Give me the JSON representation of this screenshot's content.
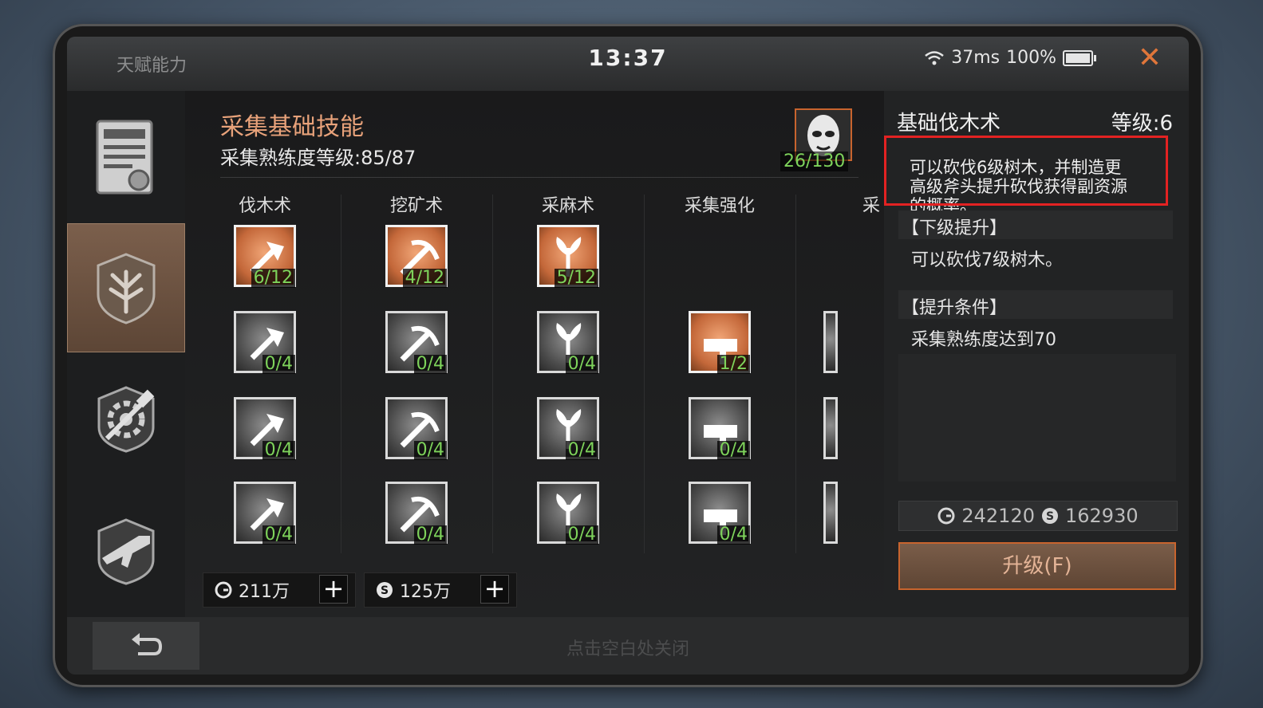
{
  "window": {
    "title": "天赋能力",
    "clock": "13:37",
    "ping": "37ms",
    "battery": "100%",
    "battery_level": 1.0
  },
  "sidebar": {
    "items": [
      {
        "icon": "trade-license-icon",
        "active": false
      },
      {
        "icon": "gathering-emblem-icon",
        "active": true
      },
      {
        "icon": "crafting-gear-hammer-icon",
        "active": false
      },
      {
        "icon": "weapon-emblem-icon",
        "active": false
      }
    ]
  },
  "main": {
    "title": "采集基础技能",
    "subtitle": "采集熟练度等级:85/87",
    "portrait_count": "26/130",
    "columns": [
      {
        "label": "伐木术",
        "skills": [
          {
            "lvl": "6/12",
            "active": true
          },
          {
            "lvl": "0/4",
            "active": false
          },
          {
            "lvl": "0/4",
            "active": false
          },
          {
            "lvl": "0/4",
            "active": false
          }
        ]
      },
      {
        "label": "挖矿术",
        "skills": [
          {
            "lvl": "4/12",
            "active": true
          },
          {
            "lvl": "0/4",
            "active": false
          },
          {
            "lvl": "0/4",
            "active": false
          },
          {
            "lvl": "0/4",
            "active": false
          }
        ]
      },
      {
        "label": "采麻术",
        "skills": [
          {
            "lvl": "5/12",
            "active": true
          },
          {
            "lvl": "0/4",
            "active": false
          },
          {
            "lvl": "0/4",
            "active": false
          },
          {
            "lvl": "0/4",
            "active": false
          }
        ]
      },
      {
        "label": "采集强化",
        "skills": [
          {
            "lvl": "1/2",
            "active": true
          },
          {
            "lvl": "0/4",
            "active": false
          },
          {
            "lvl": "0/4",
            "active": false
          }
        ]
      },
      {
        "label": "采"
      }
    ],
    "currency": [
      {
        "value": "211万",
        "icon": "gold-coin-icon"
      },
      {
        "value": "125万",
        "icon": "silver-coin-icon"
      }
    ]
  },
  "detail": {
    "name": "基础伐木术",
    "level": "等级:6",
    "desc_line1": "可以砍伐6级树木，并制造更",
    "desc_line2": "高级斧头提升砍伐获得副资源",
    "desc_line3": "的概率。",
    "next_title": "【下级提升】",
    "next_text": "可以砍伐7级树木。",
    "cond_title": "【提升条件】",
    "cond_text": "采集熟练度达到70",
    "gold": "242120",
    "silver": "162930",
    "upgrade_label": "升级(F)"
  },
  "footer": {
    "hint": "点击空白处关闭"
  },
  "colors": {
    "accent": "#c8642e",
    "progress_green": "#7ed35b",
    "highlight_red": "#e32222"
  }
}
